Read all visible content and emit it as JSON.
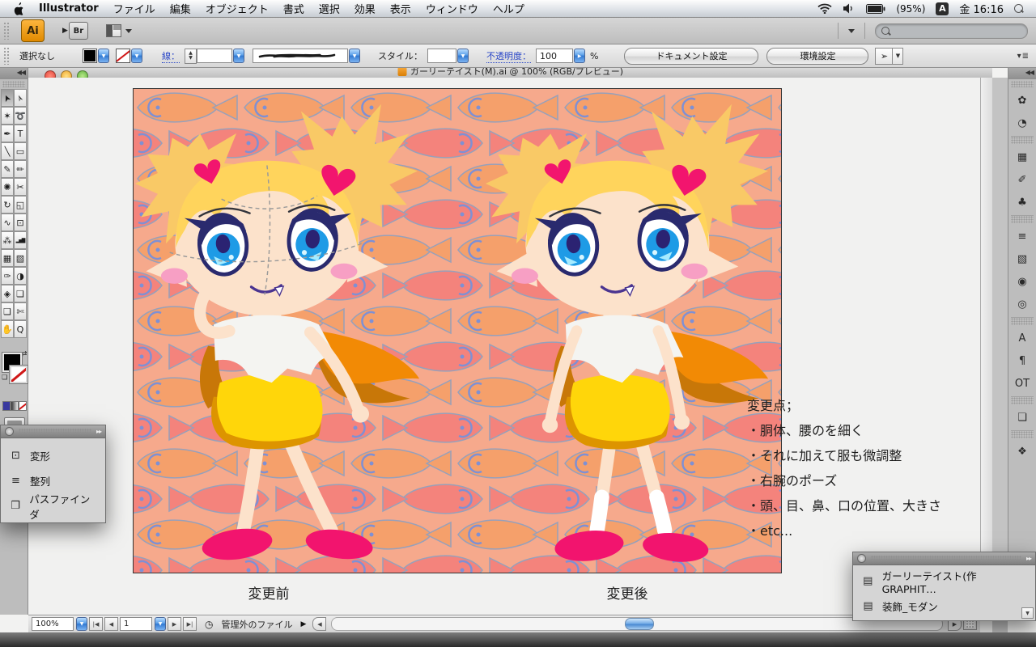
{
  "menubar": {
    "app_name": "Illustrator",
    "items": [
      "ファイル",
      "編集",
      "オブジェクト",
      "書式",
      "選択",
      "効果",
      "表示",
      "ウィンドウ",
      "ヘルプ"
    ],
    "battery_label": "(95%)",
    "input_indicator": "A",
    "clock": "金 16:16"
  },
  "appbar": {
    "ai_badge": "Ai",
    "bridge_badge": "Br"
  },
  "controlbar": {
    "selection_status": "選択なし",
    "stroke_label": "線：",
    "style_label": "スタイル：",
    "opacity_label": "不透明度：",
    "opacity_value": "100",
    "opacity_unit": "%",
    "document_setup_button": "ドキュメント設定",
    "preferences_button": "環境設定"
  },
  "window": {
    "title": "ガーリーテイスト(M).ai @ 100% (RGB/プレビュー)"
  },
  "tools": [
    {
      "name": "selection-tool",
      "glyph": "➤",
      "rot": -115,
      "selected": true
    },
    {
      "name": "direct-selection-tool",
      "glyph": "➢",
      "rot": -115
    },
    {
      "name": "magic-wand-tool",
      "glyph": "✶"
    },
    {
      "name": "lasso-tool",
      "glyph": "➰"
    },
    {
      "name": "pen-tool",
      "glyph": "✒"
    },
    {
      "name": "type-tool",
      "glyph": "T"
    },
    {
      "name": "line-segment-tool",
      "glyph": "╲"
    },
    {
      "name": "rectangle-tool",
      "glyph": "▭"
    },
    {
      "name": "paintbrush-tool",
      "glyph": "✎"
    },
    {
      "name": "pencil-tool",
      "glyph": "✏"
    },
    {
      "name": "blob-brush-tool",
      "glyph": "✺"
    },
    {
      "name": "eraser-tool",
      "glyph": "✂"
    },
    {
      "name": "rotate-tool",
      "glyph": "↻"
    },
    {
      "name": "scale-tool",
      "glyph": "◱"
    },
    {
      "name": "warp-tool",
      "glyph": "∿"
    },
    {
      "name": "free-transform-tool",
      "glyph": "⊡"
    },
    {
      "name": "symbol-sprayer-tool",
      "glyph": "⁂"
    },
    {
      "name": "graph-tool",
      "glyph": "▂▅▇",
      "small": true
    },
    {
      "name": "mesh-tool",
      "glyph": "▦"
    },
    {
      "name": "gradient-tool",
      "glyph": "▧"
    },
    {
      "name": "eyedropper-tool",
      "glyph": "✑"
    },
    {
      "name": "blend-tool",
      "glyph": "◑"
    },
    {
      "name": "live-paint-bucket-tool",
      "glyph": "◈"
    },
    {
      "name": "live-paint-selection-tool",
      "glyph": "❏"
    },
    {
      "name": "artboard-tool",
      "glyph": "❑"
    },
    {
      "name": "slice-tool",
      "glyph": "✄"
    },
    {
      "name": "hand-tool",
      "glyph": "✋"
    },
    {
      "name": "zoom-tool",
      "glyph": "Q"
    }
  ],
  "dock_panels": [
    {
      "name": "color-panel",
      "glyph": "✿"
    },
    {
      "name": "color-guide-panel",
      "glyph": "◔"
    },
    {
      "name": "swatches-panel",
      "glyph": "▦",
      "new_group": true
    },
    {
      "name": "brushes-panel",
      "glyph": "✐"
    },
    {
      "name": "symbols-panel",
      "glyph": "♣"
    },
    {
      "name": "stroke-panel",
      "glyph": "≡",
      "new_group": true
    },
    {
      "name": "gradient-panel",
      "glyph": "▧"
    },
    {
      "name": "appearance-panel",
      "glyph": "◉"
    },
    {
      "name": "transparency-panel",
      "glyph": "◎"
    },
    {
      "name": "character-panel",
      "glyph": "A",
      "new_group": true
    },
    {
      "name": "paragraph-panel",
      "glyph": "¶"
    },
    {
      "name": "opentype-panel",
      "glyph": "OT"
    },
    {
      "name": "pathfinder-panel",
      "glyph": "❏",
      "new_group": true
    },
    {
      "name": "layers-panel",
      "glyph": "❖",
      "new_group": true
    }
  ],
  "left_panel": {
    "items": [
      {
        "name": "transform",
        "label": "変形",
        "glyph": "⊡"
      },
      {
        "name": "align",
        "label": "整列",
        "glyph": "≡"
      },
      {
        "name": "pathfinder",
        "label": "パスファインダ",
        "glyph": "❒"
      }
    ]
  },
  "libraries_panel": {
    "items": [
      {
        "name": "library-girly-taste",
        "label": "ガーリーテイスト(作GRAPHIT…",
        "glyph": "▤"
      },
      {
        "name": "library-decoration-modern",
        "label": "装飾_モダン",
        "glyph": "▤"
      }
    ]
  },
  "canvas": {
    "notes": [
      "変更点；",
      "・胴体、腰のを細く",
      "・それに加えて服も微調整",
      "・右腕のポーズ",
      "・頭、目、鼻、口の位置、大きさ",
      "・etc..."
    ],
    "label_before": "変更前",
    "label_after": "変更後"
  },
  "statusbar": {
    "zoom": "100%",
    "artboard_number": "1",
    "file_status": "管理外のファイル"
  },
  "colors": {
    "fish_orange": "#F5A06B",
    "fish_salmon": "#F4837C",
    "fish_outline": "#97A0BA",
    "fish_eye": "#7E90D4",
    "pattern_bg": "#F6A98C",
    "hair": "#FFD45C",
    "pigtail": "#F9C966",
    "skin": "#FCE2CB",
    "iris": "#1E9BE6",
    "pupil": "#2B2372",
    "eye_outline": "#2A2A6E",
    "blush": "#F79FC4",
    "heart": "#F2156E",
    "blouse": "#F4F4F1",
    "skirt": "#FFD60A",
    "skirt_shadow": "#DD9400",
    "cape": "#F28A05",
    "cape_shadow": "#C87708",
    "shoes": "#F2146E",
    "sock": "#FFFFFF",
    "aqua_accent": "#4C8EDA"
  }
}
